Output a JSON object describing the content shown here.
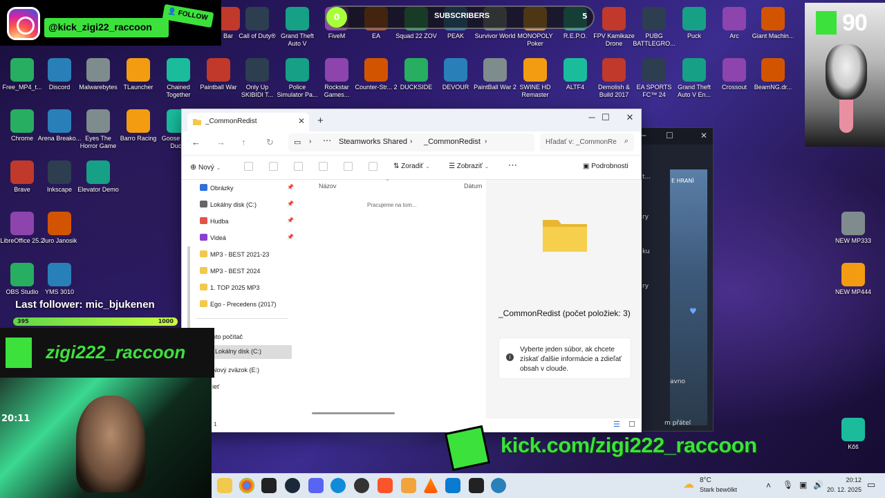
{
  "overlay": {
    "instagram_handle": "@kick_zigi22_raccoon",
    "follow_label": "FOLLOW",
    "subscribers_label": "SUBSCRIBERS",
    "subscribers_count": "5",
    "subscribers_goal_current": "0",
    "kick_counter": "90",
    "last_follower": "Last follower: mic_bjukenen",
    "follower_bar_left": "395",
    "follower_bar_right": "1000",
    "kick_banner_name": "zigi222_raccoon",
    "kick_url": "kick.com/zigi222_raccoon",
    "webcam_clock": "20:11"
  },
  "desktop_icons": [
    {
      "label": "Bar"
    },
    {
      "label": "Call of Duty®"
    },
    {
      "label": "Grand Theft Auto V"
    },
    {
      "label": "FiveM"
    },
    {
      "label": "EA"
    },
    {
      "label": "Squad 22 ZOV"
    },
    {
      "label": "PEAK"
    },
    {
      "label": "Survivor World"
    },
    {
      "label": "MONOPOLY Poker"
    },
    {
      "label": "R.E.P.O."
    },
    {
      "label": "FPV Kamikaze Drone"
    },
    {
      "label": "PUBG BATTLEGRO..."
    },
    {
      "label": "Puck"
    },
    {
      "label": "Arc"
    },
    {
      "label": "Giant Machin..."
    },
    {
      "label": "Free_MP4_t..."
    },
    {
      "label": "Discord"
    },
    {
      "label": "Malwarebytes"
    },
    {
      "label": "TLauncher"
    },
    {
      "label": "Chained Together"
    },
    {
      "label": "Paintball War"
    },
    {
      "label": "Only Up SKIBIDI T..."
    },
    {
      "label": "Police Simulator Pa..."
    },
    {
      "label": "Rockstar Games..."
    },
    {
      "label": "Counter-Str... 2"
    },
    {
      "label": "DUCKSIDE"
    },
    {
      "label": "DEVOUR"
    },
    {
      "label": "PaintBall War 2"
    },
    {
      "label": "SWINE HD Remaster"
    },
    {
      "label": "ALTF4"
    },
    {
      "label": "Demolish & Build 2017"
    },
    {
      "label": "EA SPORTS FC™ 24"
    },
    {
      "label": "Grand Theft Auto V En..."
    },
    {
      "label": "Crossout"
    },
    {
      "label": "BeamNG.dr..."
    },
    {
      "label": "Chrome"
    },
    {
      "label": "Arena Breako..."
    },
    {
      "label": "Eyes The Horror Game"
    },
    {
      "label": "Barro Racing"
    },
    {
      "label": "Goose Go... Duc..."
    },
    {
      "label": "Brave"
    },
    {
      "label": "Inkscape"
    },
    {
      "label": "Elevator Demo"
    },
    {
      "label": "LibreOffice 25.2"
    },
    {
      "label": "Juro Janosik"
    },
    {
      "label": "OBS Studio"
    },
    {
      "label": "YMS 3010"
    },
    {
      "label": "NEW MP333"
    },
    {
      "label": "NEW MP444"
    },
    {
      "label": "Kôš"
    }
  ],
  "explorer": {
    "tab_title": "_CommonRedist",
    "breadcrumb": [
      "Steamworks Shared",
      "_CommonRedist"
    ],
    "search_placeholder": "Hľadať v: _CommonRe",
    "toolbar": {
      "new_label": "Nový",
      "sort_label": "Zoradiť",
      "view_label": "Zobraziť",
      "details_label": "Podrobnosti"
    },
    "nav_items": [
      {
        "label": "Obrázky",
        "pinned": true,
        "color": "#2f6fde"
      },
      {
        "label": "Lokálny disk (C:)",
        "pinned": true,
        "color": "#666666"
      },
      {
        "label": "Hudba",
        "pinned": true,
        "color": "#e2534b"
      },
      {
        "label": "Videá",
        "pinned": true,
        "color": "#8a3fd1"
      },
      {
        "label": "MP3 - BEST 2021-23",
        "pinned": false,
        "color": "#f2c94c"
      },
      {
        "label": "MP3 - BEST 2024",
        "pinned": false,
        "color": "#f2c94c"
      },
      {
        "label": "1. TOP 2025 MP3",
        "pinned": false,
        "color": "#f2c94c"
      },
      {
        "label": "Ego - Precedens (2017)",
        "pinned": false,
        "color": "#f2c94c"
      },
      {
        "label": "nto počítač",
        "pinned": false,
        "color": "#ffffff"
      },
      {
        "label": "Lokálny disk (C:)",
        "pinned": false,
        "color": "#ffffff"
      },
      {
        "label": "Nový zväzok (E:)",
        "pinned": false,
        "color": "#ffffff"
      },
      {
        "label": "ieť",
        "pinned": false,
        "color": "#ffffff"
      }
    ],
    "column_name": "Názov",
    "column_date": "Dátum",
    "loading_text": "Pracujeme na tom...",
    "details_title": "_CommonRedist (počet položiek: 3)",
    "details_info": "Vyberte jeden súbor, ak chcete získať ďalšie informácie a zdieľať obsah v cloude.",
    "status_count": "1"
  },
  "background_window": {
    "snippets": [
      "t...",
      "E HRANÍ",
      "ry",
      "ku",
      "ry",
      "avno",
      "m přátel"
    ]
  },
  "taskbar": {
    "weather_temp": "8°C",
    "weather_desc": "Stark bewölkt",
    "time": "20:12",
    "date": "20. 12. 2025"
  },
  "colors": {
    "kick_green": "#3ce13c",
    "explorer_bg": "#ffffff",
    "taskbar_bg": "#dfe7f0"
  }
}
